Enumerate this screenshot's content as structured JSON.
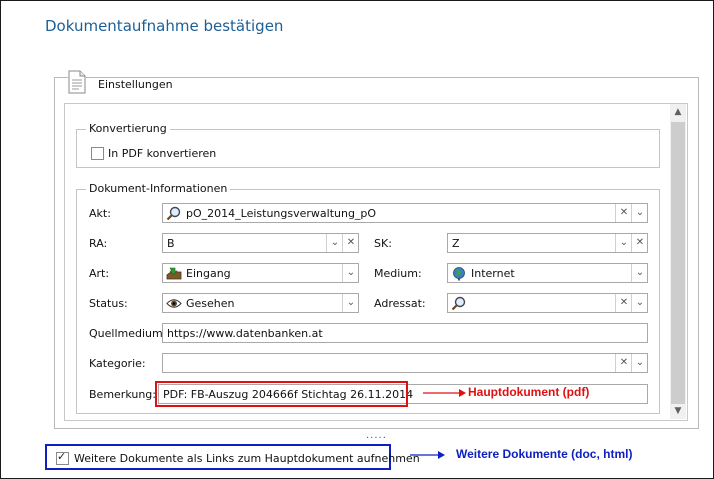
{
  "window": {
    "title": "Dokumentaufnahme bestätigen"
  },
  "settings": {
    "label": "Einstellungen"
  },
  "conversion": {
    "legend": "Konvertierung",
    "pdf_checkbox_label": "In PDF konvertieren",
    "pdf_checked": false
  },
  "doc_info": {
    "legend": "Dokument-Informationen",
    "akt": {
      "label": "Akt:",
      "value": "pO_2014_Leistungsverwaltung_pO",
      "icon": "search-icon"
    },
    "ra": {
      "label": "RA:",
      "value": "B"
    },
    "sk": {
      "label": "SK:",
      "value": "Z"
    },
    "art": {
      "label": "Art:",
      "value": "Eingang",
      "icon": "inbox-icon"
    },
    "medium": {
      "label": "Medium:",
      "value": "Internet",
      "icon": "globe-icon"
    },
    "status": {
      "label": "Status:",
      "value": "Gesehen",
      "icon": "eye-icon"
    },
    "adressat": {
      "label": "Adressat:",
      "value": "",
      "icon": "search-icon"
    },
    "quellmedium": {
      "label": "Quellmedium:",
      "value": "https://www.datenbanken.at"
    },
    "kategorie": {
      "label": "Kategorie:",
      "value": ""
    },
    "bemerkung": {
      "label": "Bemerkung:",
      "value": "PDF: FB-Auszug 204666f Stichtag 26.11.2014"
    }
  },
  "links_option": {
    "label": "Weitere Dokumente als Links zum Hauptdokument aufnehmen",
    "checked": true
  },
  "annotations": {
    "main_doc": "Hauptdokument (pdf)",
    "more_docs": "Weitere Dokumente (doc, html)",
    "red": "#e01010",
    "blue": "#1020c0"
  },
  "colors": {
    "title": "#1d5f96"
  },
  "drag_handle": "....."
}
